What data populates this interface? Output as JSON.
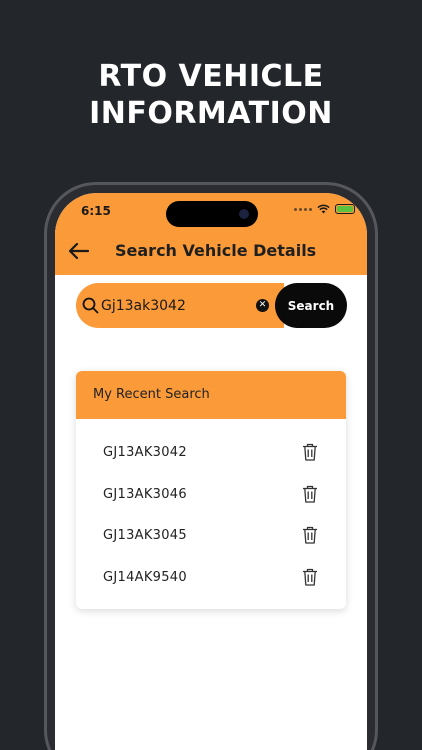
{
  "headline": {
    "line1": "RTO VEHICLE",
    "line2": "INFORMATION"
  },
  "status_bar": {
    "time": "6:15"
  },
  "appbar": {
    "title": "Search Vehicle Details",
    "back_icon": "arrow-left-icon"
  },
  "search": {
    "value": "Gj13ak3042",
    "button_label": "Search",
    "icon": "search-icon"
  },
  "recent": {
    "title": "My Recent Search",
    "items": [
      {
        "plate": "GJ13AK3042"
      },
      {
        "plate": "GJ13AK3046"
      },
      {
        "plate": "GJ13AK3045"
      },
      {
        "plate": "GJ14AK9540"
      }
    ]
  },
  "colors": {
    "accent": "#fb9a39",
    "background": "#23262b",
    "button": "#0a0a0a"
  }
}
